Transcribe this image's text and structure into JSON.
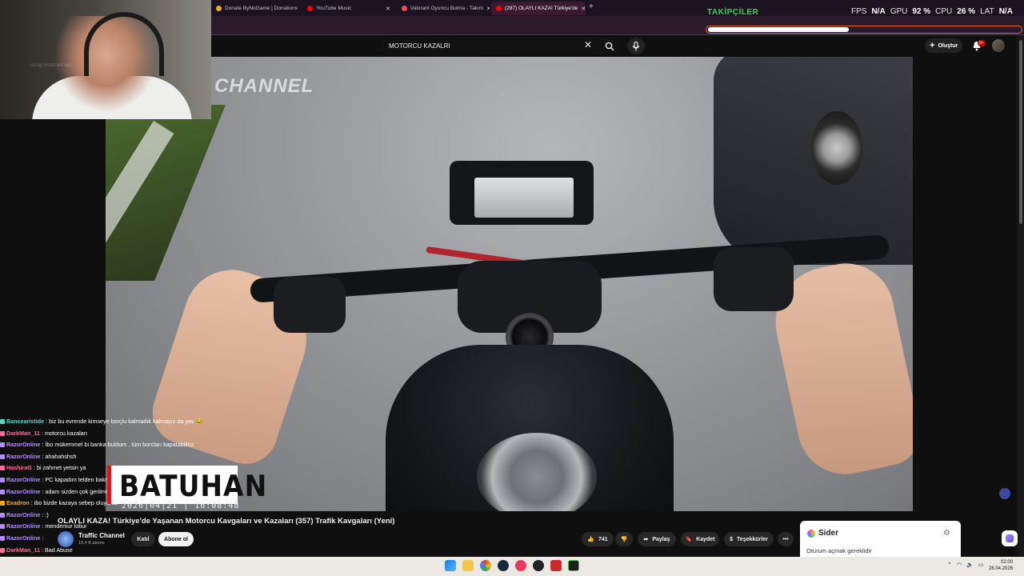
{
  "browser": {
    "tabs": [
      {
        "label": "Donate ByNoGame | Donations",
        "active": false,
        "color": "#f5a623"
      },
      {
        "label": "YouTube Music",
        "active": false,
        "color": "#ff0000"
      },
      {
        "label": "Valorant Oyuncu Bulma - Takım",
        "active": false,
        "color": "#ff4655"
      },
      {
        "label": "(287) OLAYLI KAZA! Türkiye'de",
        "active": true,
        "color": "#ff0000"
      }
    ],
    "new_tab": "+"
  },
  "youtube": {
    "search_value": "MOTORCU KAZALRI",
    "create_label": "Oluştur",
    "notif_badge": "9+",
    "video": {
      "title": "OLAYLI KAZA! Türkiye'de Yaşanan Motorcu Kavgaları ve Kazaları (357) Trafik Kavgaları (Yeni)",
      "channel": "Traffic Channel",
      "subs": "19,4 B abone",
      "watermark": "CHANNEL",
      "join_label": "Katıl",
      "subscribe_label": "Abone ol",
      "likes": "741",
      "share_label": "Paylaş",
      "save_label": "Kaydet",
      "thanks_label": "Teşekkürler",
      "more_label": "•••"
    }
  },
  "stream": {
    "followers_label": "TAKİPÇİLER",
    "follow_progress": 0.45,
    "stats": {
      "fps_label": "FPS",
      "fps_value": "N/A",
      "gpu_label": "GPU",
      "gpu_value": "92 %",
      "cpu_label": "CPU",
      "cpu_value": "26 %",
      "lat_label": "LAT",
      "lat_value": "N/A"
    },
    "webcam_watermark": "using droidcam app",
    "name_plate": "BATUHAN",
    "timestamp": "2026|04|21 | 16:08:48",
    "chat": [
      {
        "user": "Bancearistide",
        "msg": ": biz bu evrende kimseye borçlu kalmadık kalmayız da yav 😂",
        "color": "#5bd6c7"
      },
      {
        "user": "DarkMan_11",
        "msg": ": motorcu kazaları",
        "color": "#ff6b9a"
      },
      {
        "user": "RazorOnline",
        "msg": ": İbo mükemmel bi banka buldum , tüm borcları kapatabiliriz",
        "color": "#b58cff"
      },
      {
        "user": "RazorOnline",
        "msg": ": ahahahshsh",
        "color": "#b58cff"
      },
      {
        "user": "HashiraG",
        "msg": ": bi zahmet yetsin ya",
        "color": "#ff6b9a"
      },
      {
        "user": "RazorOnline",
        "msg": ": PC kapadım telden bakıyorum motoru kazalarını",
        "color": "#b58cff"
      },
      {
        "user": "RazorOnline",
        "msg": ": adam sizden çok gerilmiş hahshshssh",
        "color": "#b58cff"
      },
      {
        "user": "Exadron",
        "msg": ": ibo bizde kazaya sebep oluyoruz",
        "color": "#f5a623"
      },
      {
        "user": "RazorOnline",
        "msg": ": :)",
        "color": "#b58cff"
      },
      {
        "user": "RazorOnline",
        "msg": ": mendemur lobur",
        "color": "#b58cff"
      },
      {
        "user": "RazorOnline",
        "msg": ":",
        "color": "#b58cff"
      },
      {
        "user": "DarkMan_11",
        "msg": ": Bad Abuse",
        "color": "#ff6b9a"
      }
    ]
  },
  "sider": {
    "title": "Sider",
    "subtitle": "Oturum açmak gereklidir"
  },
  "taskbar": {
    "time": "02:00",
    "date": "26.04.2026"
  }
}
